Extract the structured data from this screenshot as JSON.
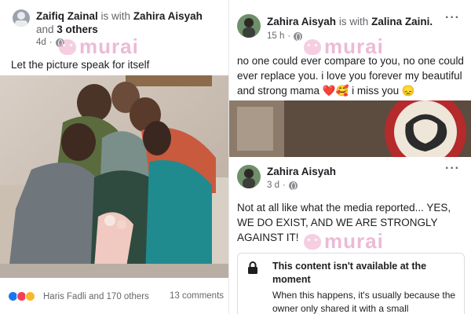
{
  "left_post": {
    "author": "Zaifiq Zainal",
    "with_text": "is with",
    "tagged": "Zahira Aisyah",
    "and_text": "and",
    "others": "3 others",
    "time": "4d",
    "caption": "Let the picture speak for itself",
    "reactions_text": "Haris Fadli and 170 others",
    "comments_text": "13 comments",
    "reaction_colors": [
      "#1877f2",
      "#f33e58",
      "#f7b928"
    ]
  },
  "right_post_1": {
    "author": "Zahira Aisyah",
    "with_text": "is with",
    "tagged": "Zalina Zaini.",
    "time": "15 h",
    "text": "no one could ever compare to you, no one could ever replace you. i love you forever my beautiful and strong mama ❤️🥰 i miss you 😞",
    "menu": "···"
  },
  "right_post_2": {
    "author": "Zahira Aisyah",
    "time": "3 d",
    "text": "Not at all like what the media reported... YES, WE DO EXIST, AND WE ARE STRONGLY AGAINST IT!",
    "menu": "···",
    "unavailable_title": "This content isn't available at the moment",
    "unavailable_body": "When this happens, it's usually because the owner only shared it with a small"
  },
  "watermark": "murai"
}
